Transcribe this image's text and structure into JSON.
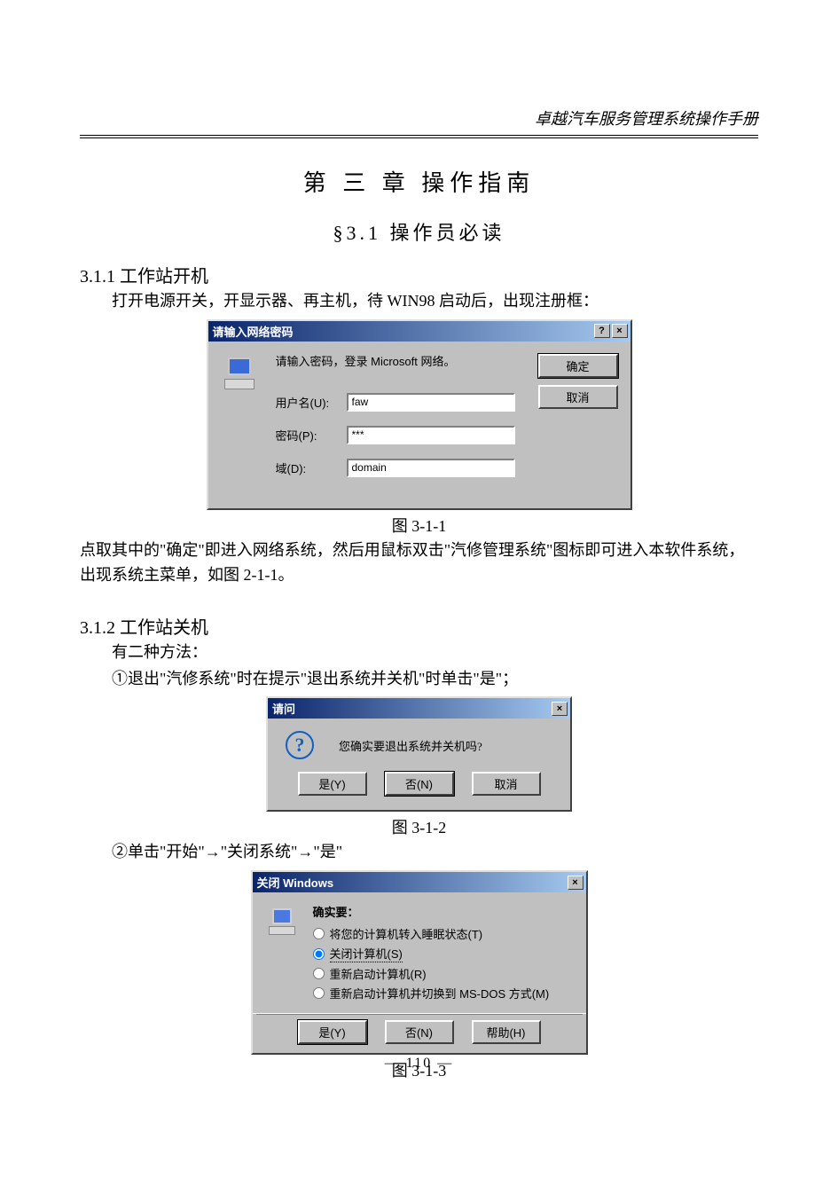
{
  "header": {
    "manual_title": "卓越汽车服务管理系统操作手册"
  },
  "chapter": {
    "title": "第 三 章   操作指南"
  },
  "section": {
    "title": "§3.1   操作员必读"
  },
  "sub1": {
    "num_title": "3.1.1   工作站开机",
    "text": "打开电源开关，开显示器、再主机，待 WIN98 启动后，出现注册框："
  },
  "dialog1": {
    "title": "请输入网络密码",
    "prompt": "请输入密码，登录 Microsoft 网络。",
    "label_user": "用户名(U):",
    "label_pass": "密码(P):",
    "label_domain": "域(D):",
    "value_user": "faw",
    "value_pass": "***",
    "value_domain": "domain",
    "btn_ok": "确定",
    "btn_cancel": "取消",
    "help_glyph": "?",
    "close_glyph": "×"
  },
  "caption1": "图 3-1-1",
  "after_dlg1": "点取其中的\"确定\"即进入网络系统，然后用鼠标双击\"汽修管理系统\"图标即可进入本软件系统，出现系统主菜单，如图 2-1-1。",
  "sub2": {
    "num_title": "3.1.2   工作站关机",
    "line1": "有二种方法：",
    "line2": "①退出\"汽修系统\"时在提示\"退出系统并关机\"时单击\"是\"；"
  },
  "dialog2": {
    "title": "请问",
    "message": "您确实要退出系统并关机吗?",
    "btn_yes": "是(Y)",
    "btn_no": "否(N)",
    "btn_cancel": "取消",
    "close_glyph": "×",
    "qmark": "?"
  },
  "caption2": "图 3-1-2",
  "between_text": "②单击\"开始\"→\"关闭系统\"→\"是\"",
  "dialog3": {
    "title": "关闭 Windows",
    "heading": "确实要：",
    "opt1": "将您的计算机转入睡眠状态(T)",
    "opt2": "关闭计算机(S)",
    "opt3": "重新启动计算机(R)",
    "opt4": "重新启动计算机并切换到 MS-DOS 方式(M)",
    "btn_yes": "是(Y)",
    "btn_no": "否(N)",
    "btn_help": "帮助(H)",
    "close_glyph": "×"
  },
  "caption3": "图 3-1-3",
  "page_number": "—  110  —"
}
